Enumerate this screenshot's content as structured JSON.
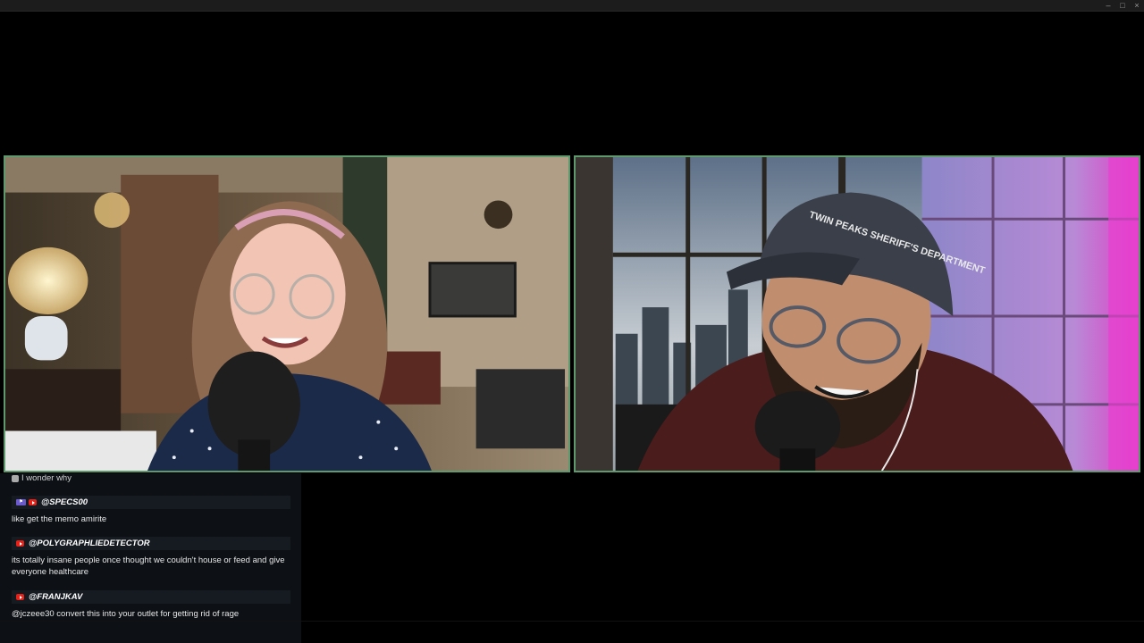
{
  "window": {
    "controls": {
      "minimize": "–",
      "maximize": "□",
      "close": "×"
    }
  },
  "chat": {
    "top_partial_message": "I wonder why",
    "messages": [
      {
        "username": "@SPECS00",
        "text": "like get the memo amirite",
        "badges": [
          "member-badge",
          "youtube-icon"
        ]
      },
      {
        "username": "@POLYGRAPHLIEDETECTOR",
        "text": "its totally insane people once thought we couldn't house or feed and give everyone healthcare",
        "badges": [
          "youtube-icon"
        ]
      },
      {
        "username": "@FRANJKAV",
        "text": "@jczeee30 convert this into your outlet for getting rid of rage",
        "badges": [
          "youtube-icon"
        ]
      }
    ]
  },
  "colors": {
    "tile_border": "#5f9a6f",
    "youtube_red": "#e62117",
    "chat_bg": "#0d1116",
    "chat_header_bg": "#161b22"
  },
  "right_tile": {
    "cap_text": "TWIN PEAKS SHERIFF'S DEPARTMENT"
  }
}
